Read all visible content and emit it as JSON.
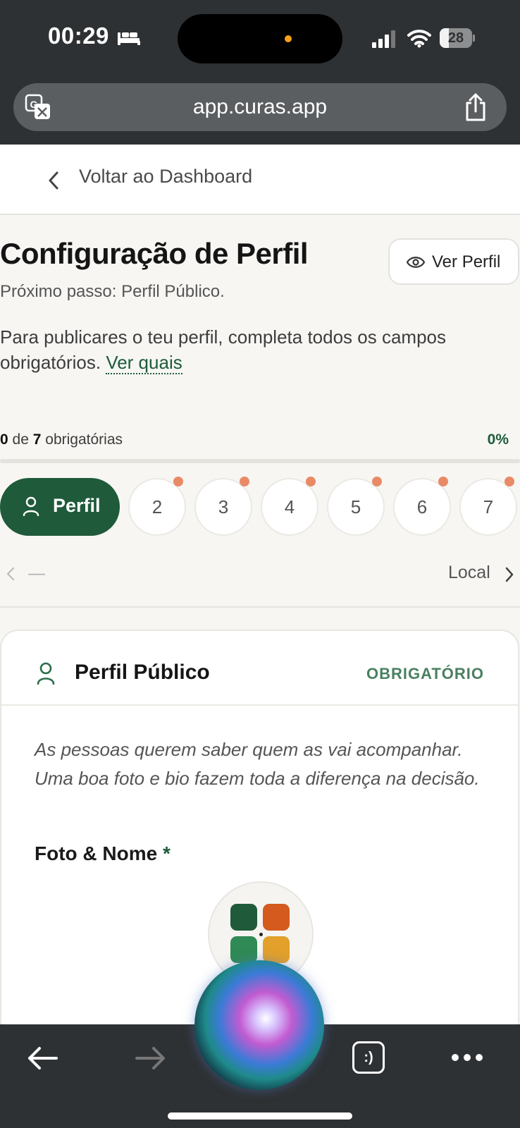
{
  "status_bar": {
    "time": "00:29",
    "battery_level": "28",
    "battery_fraction": 0.28,
    "icons": [
      "bed-icon",
      "signal-icon",
      "wifi-icon",
      "battery-icon"
    ]
  },
  "browser": {
    "url": "app.curas.app",
    "icons": [
      "translate-icon",
      "share-icon"
    ]
  },
  "nav": {
    "back_label": "Voltar ao Dashboard"
  },
  "header": {
    "title": "Configuração de Perfil",
    "next_step": "Próximo passo: Perfil Público.",
    "view_profile_label": "Ver Perfil",
    "description": "Para publicares o teu perfil, completa todos os campos obrigatórios.",
    "see_which_link": "Ver quais"
  },
  "progress": {
    "completed": "0",
    "connector": "de",
    "total": "7",
    "suffix": "obrigatórias",
    "percent_label": "0%",
    "percent_value": 0
  },
  "steps": {
    "active_label": "Perfil",
    "items": [
      "2",
      "3",
      "4",
      "5",
      "6",
      "7"
    ],
    "prev_label": "—",
    "next_label": "Local"
  },
  "card": {
    "title": "Perfil Público",
    "badge": "OBRIGATÓRIO",
    "intro": "As pessoas querem saber quem as vai acompanhar. Uma boa foto e bio fazem toda a diferença na decisão.",
    "field_label": "Foto & Nome",
    "required_mark": "*"
  },
  "toolbar": {
    "tabs_label": ":)",
    "icons": [
      "back-arrow-icon",
      "forward-arrow-icon",
      "tabs-icon",
      "more-icon"
    ]
  },
  "colors": {
    "brand_green": "#1f5a3a",
    "accent_dot": "#e98a66",
    "logo": [
      "#1f5a3a",
      "#d45a1e",
      "#2f8a55",
      "#e3a02a"
    ]
  }
}
